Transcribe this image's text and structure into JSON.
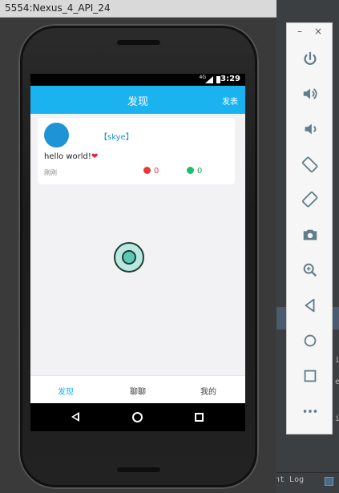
{
  "window": {
    "title": "5554:Nexus_4_API_24"
  },
  "status_bar": {
    "time": "3:29",
    "network": "4G"
  },
  "app_bar": {
    "title": "发现",
    "action": "发表"
  },
  "post": {
    "username": "【skye】",
    "message": "hello world!",
    "emoji": "❤",
    "time": "刚刚",
    "likes": "0",
    "comments": "0"
  },
  "tabs": [
    {
      "label": "发现",
      "active": true
    },
    {
      "label": "聊聊",
      "active": false
    },
    {
      "label": "我的",
      "active": false
    }
  ],
  "panel": {
    "minimize": "–",
    "close": "×",
    "buttons": [
      "power-icon",
      "volume-up-icon",
      "volume-down-icon",
      "rotate-left-icon",
      "rotate-right-icon",
      "camera-icon",
      "zoom-icon",
      "back-icon",
      "home-icon",
      "overview-icon",
      "more-icon"
    ]
  },
  "ide": {
    "frag1": "is",
    "frag2": "ea",
    "frag3": "in",
    "bottom_label": "nt Log"
  },
  "colors": {
    "accent": "#1ab2ef",
    "avatar": "#1e93d6",
    "like": "#e53935",
    "comment": "#19c16a"
  }
}
